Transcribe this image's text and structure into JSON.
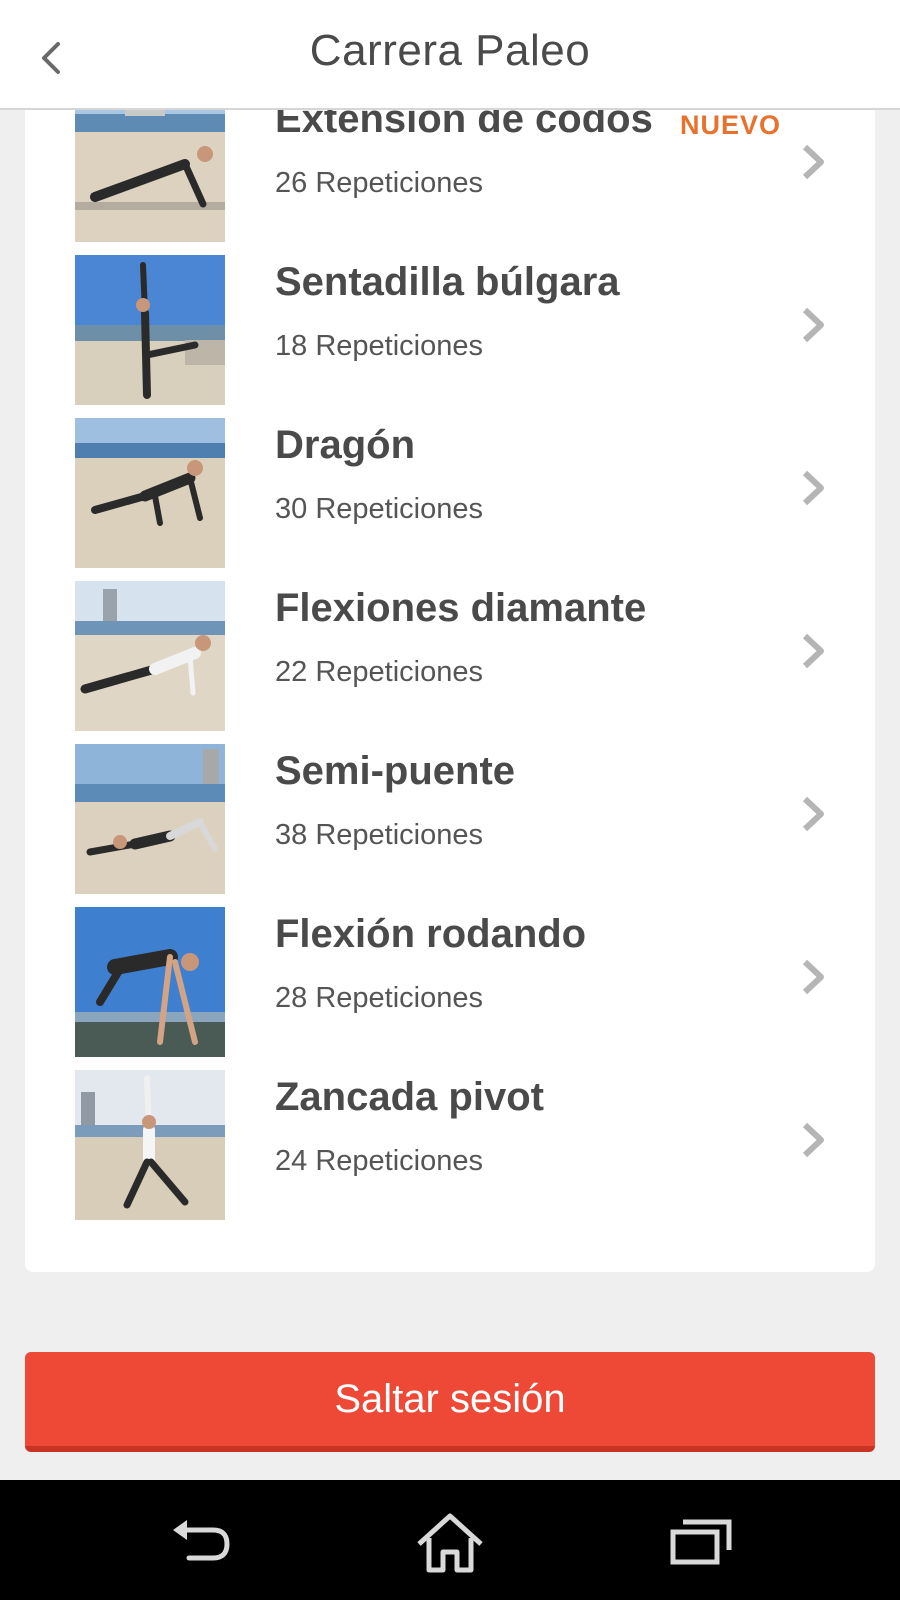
{
  "header": {
    "title": "Carrera Paleo",
    "back_icon": "chevron-left-icon"
  },
  "exercises": [
    {
      "name": "Extensión de codos",
      "reps": "26 Repeticiones",
      "badge": "NUEVO",
      "pose": "plank"
    },
    {
      "name": "Sentadilla búlgara",
      "reps": "18 Repeticiones",
      "badge": "",
      "pose": "lunge-reach"
    },
    {
      "name": "Dragón",
      "reps": "30 Repeticiones",
      "badge": "",
      "pose": "crawl"
    },
    {
      "name": "Flexiones diamante",
      "reps": "22 Repeticiones",
      "badge": "",
      "pose": "pushup"
    },
    {
      "name": "Semi-puente",
      "reps": "38 Repeticiones",
      "badge": "",
      "pose": "bridge"
    },
    {
      "name": "Flexión rodando",
      "reps": "28 Repeticiones",
      "badge": "",
      "pose": "roll"
    },
    {
      "name": "Zancada pivot",
      "reps": "24 Repeticiones",
      "badge": "",
      "pose": "lunge"
    }
  ],
  "skip_button": {
    "label": "Saltar sesión"
  },
  "navbar": {
    "icons": [
      "back-arrow-icon",
      "home-icon",
      "recent-apps-icon"
    ]
  },
  "colors": {
    "accent": "#ee4836",
    "badge": "#e8722d",
    "text": "#4a4a4a",
    "background": "#efefef"
  }
}
